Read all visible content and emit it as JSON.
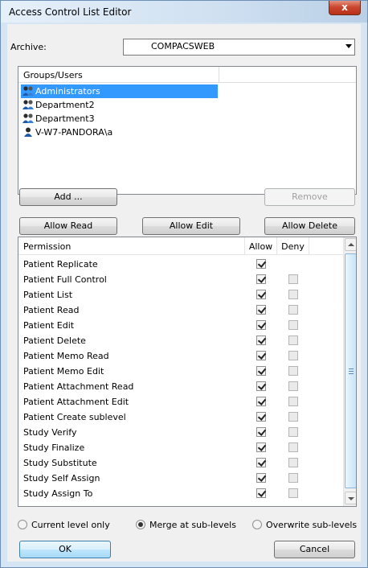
{
  "window": {
    "title": "Access Control List Editor",
    "close_glyph": "x"
  },
  "archive": {
    "label": "Archive:",
    "value": "COMPACSWEB"
  },
  "groups": {
    "header": "Groups/Users",
    "items": [
      {
        "name": "Administrators",
        "selected": true,
        "icon": "group-icon"
      },
      {
        "name": "Department2",
        "selected": false,
        "icon": "group-icon"
      },
      {
        "name": "Department3",
        "selected": false,
        "icon": "group-icon"
      },
      {
        "name": "V-W7-PANDORA\\a",
        "selected": false,
        "icon": "user-icon"
      }
    ]
  },
  "buttons": {
    "add": "Add ...",
    "remove": "Remove",
    "allow_read": "Allow Read",
    "allow_edit": "Allow Edit",
    "allow_delete": "Allow Delete",
    "ok": "OK",
    "cancel": "Cancel"
  },
  "permissions": {
    "headers": {
      "permission": "Permission",
      "allow": "Allow",
      "deny": "Deny"
    },
    "rows": [
      {
        "name": "Patient Replicate",
        "allow": true,
        "deny_visible": false
      },
      {
        "name": "Patient Full Control",
        "allow": true,
        "deny_visible": true
      },
      {
        "name": "Patient List",
        "allow": true,
        "deny_visible": true
      },
      {
        "name": "Patient Read",
        "allow": true,
        "deny_visible": true
      },
      {
        "name": "Patient Edit",
        "allow": true,
        "deny_visible": true
      },
      {
        "name": "Patient Delete",
        "allow": true,
        "deny_visible": true
      },
      {
        "name": "Patient Memo Read",
        "allow": true,
        "deny_visible": true
      },
      {
        "name": "Patient Memo Edit",
        "allow": true,
        "deny_visible": true
      },
      {
        "name": "Patient Attachment Read",
        "allow": true,
        "deny_visible": true
      },
      {
        "name": "Patient Attachment Edit",
        "allow": true,
        "deny_visible": true
      },
      {
        "name": "Patient Create sublevel",
        "allow": true,
        "deny_visible": true
      },
      {
        "name": "Study Verify",
        "allow": true,
        "deny_visible": true
      },
      {
        "name": "Study Finalize",
        "allow": true,
        "deny_visible": true
      },
      {
        "name": "Study Substitute",
        "allow": true,
        "deny_visible": true
      },
      {
        "name": "Study Self Assign",
        "allow": true,
        "deny_visible": true
      },
      {
        "name": "Study Assign To",
        "allow": true,
        "deny_visible": true
      }
    ]
  },
  "scope": {
    "options": [
      {
        "label": "Current level only",
        "selected": false
      },
      {
        "label": "Merge at sub-levels",
        "selected": true
      },
      {
        "label": "Overwrite sub-levels",
        "selected": false
      }
    ]
  },
  "colors": {
    "selection": "#3399ff",
    "close_button": "#c9452d"
  }
}
